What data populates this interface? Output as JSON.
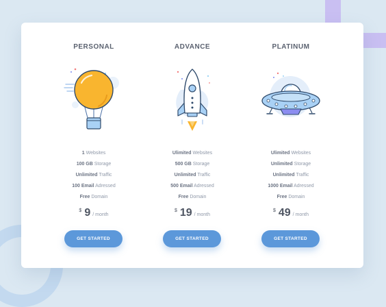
{
  "plans": [
    {
      "title": "PERSONAL",
      "icon": "hot-air-balloon-icon",
      "features": [
        {
          "strong": "1",
          "label": "Websites"
        },
        {
          "strong": "100 GB",
          "label": "Storage"
        },
        {
          "strong": "Unlimited",
          "label": "Traffic"
        },
        {
          "strong": "100 Email",
          "label": "Adressed"
        },
        {
          "strong": "Free",
          "label": "Domain"
        }
      ],
      "price": {
        "currency": "$",
        "amount": "9",
        "period": "/ month"
      },
      "cta_label": "GET STARTED"
    },
    {
      "title": "ADVANCE",
      "icon": "rocket-icon",
      "features": [
        {
          "strong": "Ulimited",
          "label": "Websites"
        },
        {
          "strong": "500 GB",
          "label": "Storage"
        },
        {
          "strong": "Unlimited",
          "label": "Traffic"
        },
        {
          "strong": "500 Email",
          "label": "Adressed"
        },
        {
          "strong": "Free",
          "label": "Domain"
        }
      ],
      "price": {
        "currency": "$",
        "amount": "19",
        "period": "/ month"
      },
      "cta_label": "GET STARTED"
    },
    {
      "title": "PLATINUM",
      "icon": "ufo-icon",
      "features": [
        {
          "strong": "Ulimited",
          "label": "Websites"
        },
        {
          "strong": "Unlimited",
          "label": "Storage"
        },
        {
          "strong": "Unlimited",
          "label": "Traffic"
        },
        {
          "strong": "1000 Email",
          "label": "Adressed"
        },
        {
          "strong": "Free",
          "label": "Domain"
        }
      ],
      "price": {
        "currency": "$",
        "amount": "49",
        "period": "/ month"
      },
      "cta_label": "GET STARTED"
    }
  ],
  "colors": {
    "background": "#dbe8f2",
    "card": "#ffffff",
    "accent": "#5c98da",
    "balloon": "#f9b52f",
    "decor_purple": "#c9bff2",
    "decor_blue": "#c3d9ef"
  }
}
